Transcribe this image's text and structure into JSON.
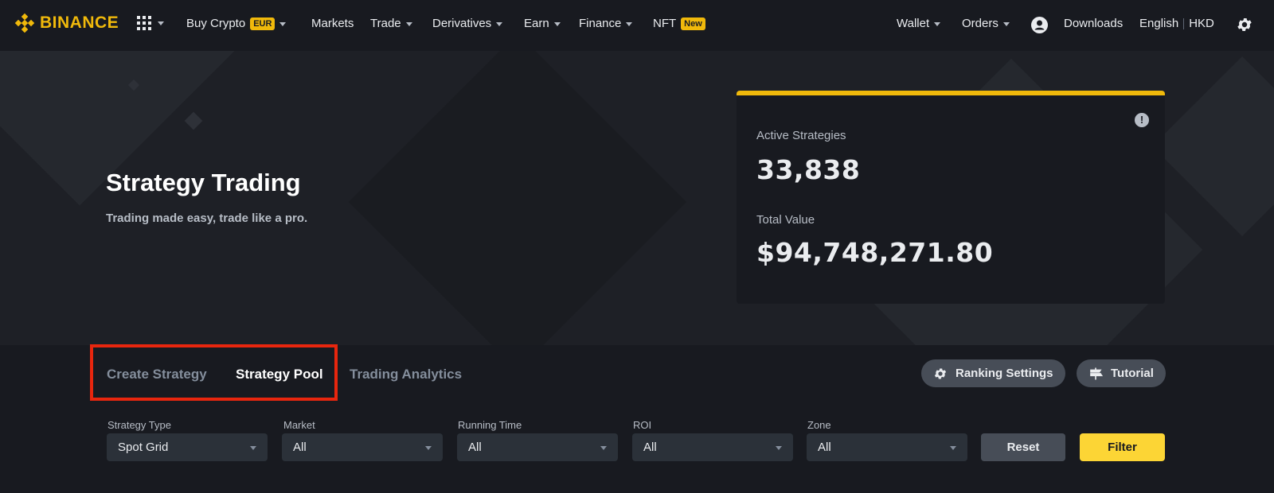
{
  "brand": {
    "name": "BINANCE",
    "accent": "#f0b90b"
  },
  "nav": {
    "buy_crypto": "Buy Crypto",
    "buy_crypto_badge": "EUR",
    "markets": "Markets",
    "trade": "Trade",
    "derivatives": "Derivatives",
    "earn": "Earn",
    "finance": "Finance",
    "nft": "NFT",
    "nft_badge": "New",
    "wallet": "Wallet",
    "orders": "Orders",
    "downloads": "Downloads",
    "language": "English",
    "currency": "HKD"
  },
  "hero": {
    "title": "Strategy Trading",
    "subtitle": "Trading made easy, trade like a pro.",
    "active_label": "Active Strategies",
    "active_value": "33,838",
    "total_label": "Total Value",
    "total_value": "$94,748,271.80"
  },
  "tabs": [
    {
      "label": "Create Strategy",
      "active": false
    },
    {
      "label": "Strategy Pool",
      "active": true
    },
    {
      "label": "Trading Analytics",
      "active": false
    }
  ],
  "actions": {
    "ranking_settings": "Ranking Settings",
    "tutorial": "Tutorial"
  },
  "filters": [
    {
      "label": "Strategy Type",
      "value": "Spot Grid"
    },
    {
      "label": "Market",
      "value": "All"
    },
    {
      "label": "Running Time",
      "value": "All"
    },
    {
      "label": "ROI",
      "value": "All"
    },
    {
      "label": "Zone",
      "value": "All"
    }
  ],
  "buttons": {
    "reset": "Reset",
    "filter": "Filter"
  },
  "icons": [
    "binance-logo-icon",
    "apps-grid-icon",
    "user-avatar-icon",
    "settings-gear-icon",
    "info-icon",
    "gear-icon",
    "tutorial-icon"
  ]
}
